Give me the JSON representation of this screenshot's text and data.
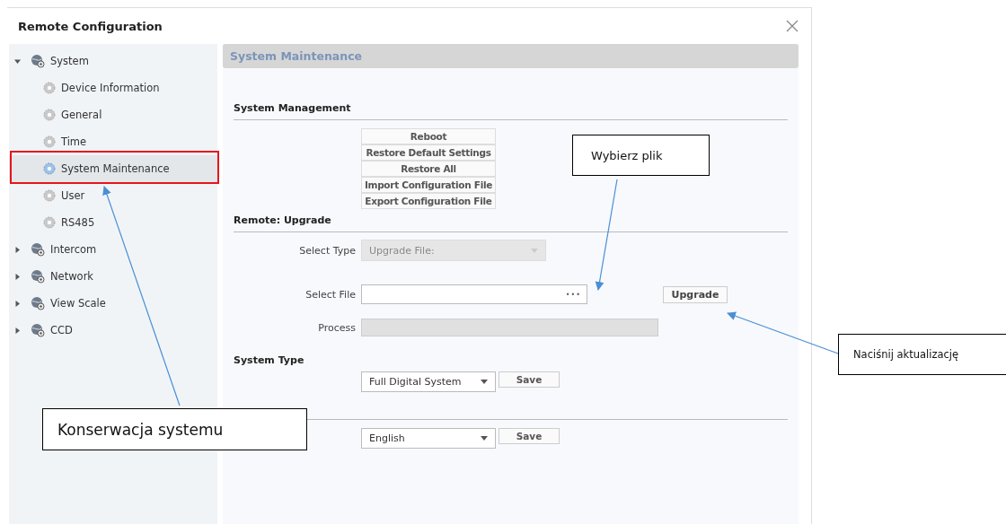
{
  "window": {
    "title": "Remote Configuration"
  },
  "tree": [
    {
      "label": "System",
      "expanded": true,
      "selected": false,
      "children": [
        {
          "label": "Device Information",
          "selected": false
        },
        {
          "label": "General",
          "selected": false
        },
        {
          "label": "Time",
          "selected": false
        },
        {
          "label": "System Maintenance",
          "selected": true
        },
        {
          "label": "User",
          "selected": false
        },
        {
          "label": "RS485",
          "selected": false
        }
      ]
    },
    {
      "label": "Intercom",
      "expanded": false,
      "selected": false
    },
    {
      "label": "Network",
      "expanded": false,
      "selected": false
    },
    {
      "label": "View Scale",
      "expanded": false,
      "selected": false
    },
    {
      "label": "CCD",
      "expanded": false,
      "selected": false
    }
  ],
  "panel": {
    "title": "System Maintenance",
    "system_management": {
      "title": "System Management",
      "buttons": [
        "Reboot",
        "Restore Default Settings",
        "Restore All",
        "Import Configuration File",
        "Export Configuration File"
      ]
    },
    "remote_upgrade": {
      "title": "Remote: Upgrade",
      "select_type": {
        "label": "Select Type",
        "value": "Upgrade File:",
        "disabled": true
      },
      "select_file": {
        "label": "Select File",
        "browse": "•••"
      },
      "upgrade_button": "Upgrade",
      "process": {
        "label": "Process",
        "level": 0
      }
    },
    "system_type": {
      "title": "System Type",
      "value": "Full Digital System",
      "save": "Save"
    },
    "language": {
      "value": "English",
      "save": "Save"
    }
  },
  "callouts": [
    "Wybierz plik",
    "Naciśnij aktualizację",
    "Konserwacja systemu"
  ]
}
